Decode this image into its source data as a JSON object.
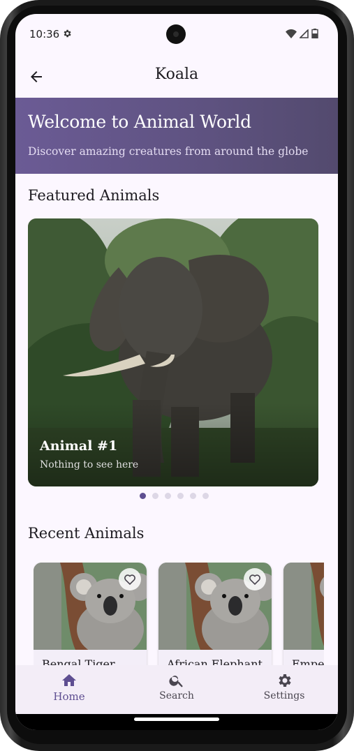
{
  "status_bar": {
    "time": "10:36"
  },
  "app_bar": {
    "title": "Koala"
  },
  "hero": {
    "title": "Welcome to Animal World",
    "subtitle": "Discover amazing creatures from around the globe"
  },
  "featured": {
    "section_title": "Featured Animals",
    "slide": {
      "title": "Animal #1",
      "subtitle": "Nothing to see here",
      "image": "elephant-photo"
    },
    "pager": {
      "count": 6,
      "active_index": 0
    }
  },
  "recent": {
    "section_title": "Recent Animals",
    "cards": [
      {
        "name": "Bengal Tiger",
        "image": "koala-photo",
        "favorite_icon": "heart-outline-icon"
      },
      {
        "name": "African Elephant",
        "image": "koala-photo",
        "favorite_icon": "heart-outline-icon"
      },
      {
        "name": "Emperor Penguin",
        "image": "koala-photo",
        "favorite_icon": "heart-outline-icon"
      }
    ]
  },
  "bottom_nav": {
    "items": [
      {
        "label": "Home",
        "icon": "home-icon",
        "active": true
      },
      {
        "label": "Search",
        "icon": "search-icon",
        "active": false
      },
      {
        "label": "Settings",
        "icon": "settings-icon",
        "active": false
      }
    ]
  },
  "colors": {
    "accent": "#5e4e91",
    "hero_bg": "#6b5b95",
    "screen_bg": "#fcf7ff",
    "nav_bg": "#f3edf7"
  }
}
